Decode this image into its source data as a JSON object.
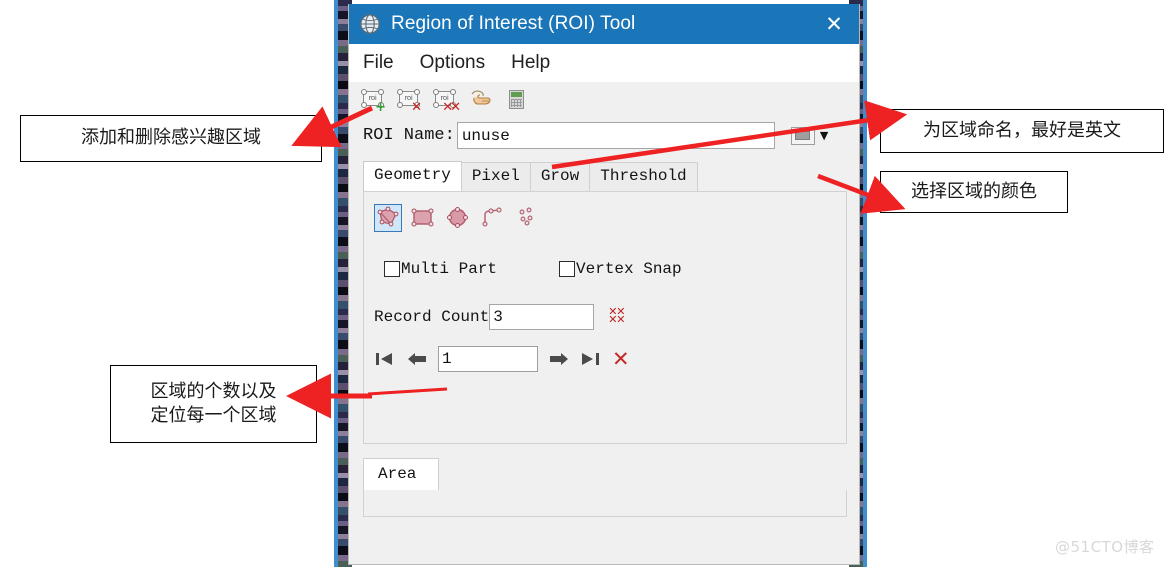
{
  "window": {
    "title": "Region of Interest (ROI) Tool",
    "close_label": "✕",
    "icon": "roi-globe-icon",
    "titlebar_color": "#1a76b8"
  },
  "menubar": {
    "items": [
      {
        "label": "File",
        "name": "menu-file"
      },
      {
        "label": "Options",
        "name": "menu-options"
      },
      {
        "label": "Help",
        "name": "menu-help"
      }
    ]
  },
  "toolbar": {
    "buttons": [
      {
        "name": "add-roi-button",
        "icon": "roi-add-icon",
        "badge": "+"
      },
      {
        "name": "delete-roi-button",
        "icon": "roi-delete-icon",
        "badge": "✕"
      },
      {
        "name": "delete-all-roi-button",
        "icon": "roi-delete-all-icon",
        "badge": "✕✕"
      },
      {
        "name": "pointer-hand-button",
        "icon": "hand-pointer-icon",
        "badge": ""
      },
      {
        "name": "statistics-button",
        "icon": "calculator-icon",
        "badge": ""
      }
    ]
  },
  "roi_name": {
    "label": "ROI Name:",
    "value": "unuse",
    "placeholder": "",
    "color_button_name": "roi-color-button",
    "color_swatch_hex": "#9f9f9f",
    "caret": "▼"
  },
  "tabs": {
    "items": [
      {
        "label": "Geometry",
        "active": true
      },
      {
        "label": "Pixel",
        "active": false
      },
      {
        "label": "Grow",
        "active": false
      },
      {
        "label": "Threshold",
        "active": false
      }
    ]
  },
  "geometry": {
    "shapes": [
      {
        "name": "polygon-tool",
        "selected": true
      },
      {
        "name": "rectangle-tool",
        "selected": false
      },
      {
        "name": "ellipse-tool",
        "selected": false
      },
      {
        "name": "polyline-tool",
        "selected": false
      },
      {
        "name": "point-tool",
        "selected": false
      }
    ],
    "shape_color": "#d99aa6",
    "checkboxes": [
      {
        "label": "Multi Part",
        "checked": false,
        "name": "multi-part-checkbox"
      },
      {
        "label": "Vertex Snap",
        "checked": false,
        "name": "vertex-snap-checkbox"
      }
    ],
    "record_count": {
      "label": "Record Count",
      "value": "3",
      "clear_icon": "red-xx-grid-icon"
    },
    "navigation": {
      "first": "❘◀",
      "previous": "◀",
      "value": "1",
      "next": "▶",
      "last": "▶❘",
      "delete": "✕"
    }
  },
  "bottom": {
    "tab_label": "Area"
  },
  "annotations": {
    "add_delete": "添加和删除感兴趣区域",
    "name_region": "为区域命名，最好是英文",
    "pick_color": "选择区域的颜色",
    "count_line1": "区域的个数以及",
    "count_line2": "定位每一个区域",
    "arrow_color": "#ee2222"
  },
  "watermark": "@51CTO博客"
}
